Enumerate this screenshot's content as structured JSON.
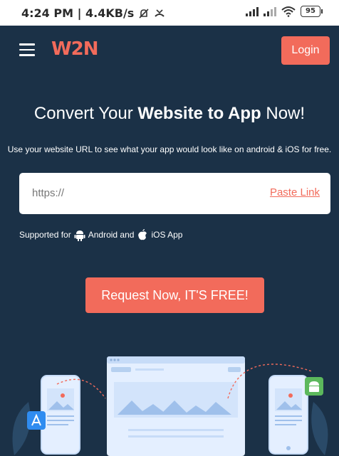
{
  "status": {
    "time_speed": "4:24 PM | 4.4KB/s",
    "battery": "95"
  },
  "header": {
    "logo": "W2N",
    "login_label": "Login"
  },
  "hero": {
    "title_prefix": "Convert Your ",
    "title_bold": "Website to App",
    "title_suffix": " Now!",
    "subtitle": "Use your website URL to see what your app would look like on android & iOS for free."
  },
  "url_form": {
    "placeholder": "https://",
    "paste_label": "Paste Link"
  },
  "supported": {
    "prefix": "Supported for",
    "android": "Android and",
    "ios": "iOS App"
  },
  "cta": {
    "label": "Request Now, IT'S FREE!"
  },
  "colors": {
    "background": "#1b3147",
    "accent": "#f26b5b"
  }
}
